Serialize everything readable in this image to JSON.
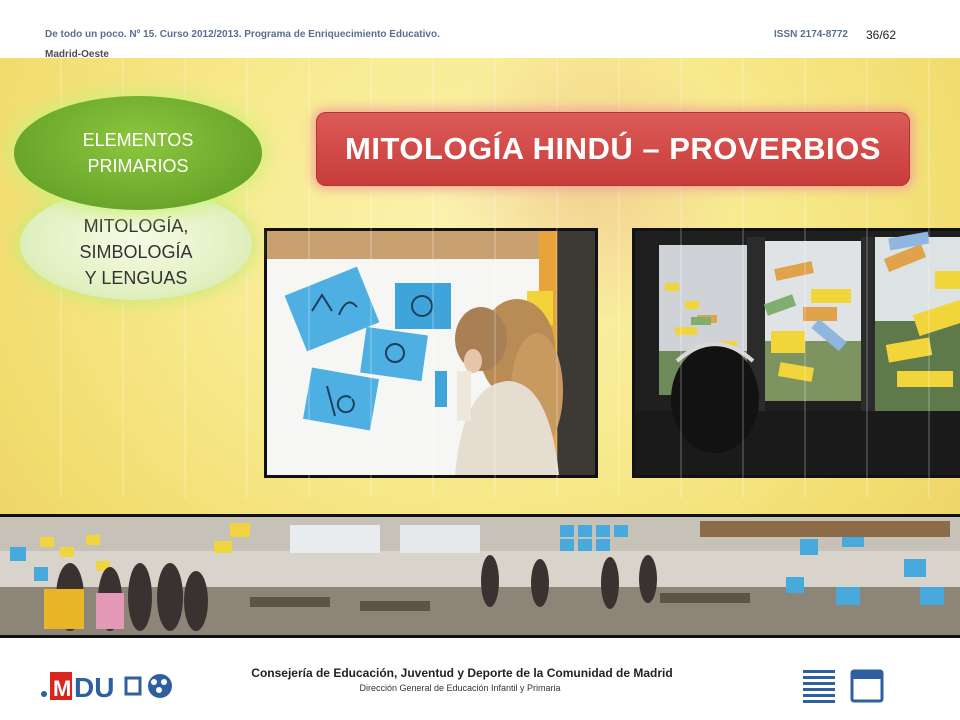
{
  "header": {
    "journal": "De todo un poco. Nº 15.  Curso 2012/2013. Programa de Enriquecimiento Educativo.",
    "region": "Madrid-Oeste",
    "issn": "ISSN 2174-8772",
    "page": "36/62"
  },
  "slide": {
    "title": "MITOLOGÍA HINDÚ – PROVERBIOS",
    "oval_top": [
      "ELEMENTOS",
      "PRIMARIOS"
    ],
    "oval_bottom": [
      "MITOLOGÍA,",
      "SIMBOLOGÍA",
      "Y LENGUAS"
    ]
  },
  "footer": {
    "logo": "MDU",
    "line1": "Consejería de Educación, Juventud y Deporte de la Comunidad de Madrid",
    "line2": "Dirección General de Educación Infantil y Primaria"
  },
  "icons": [
    "index-icon",
    "window-icon"
  ],
  "colors": {
    "green": "#6aa62a",
    "red": "#c83c3a",
    "blue": "#2f5f9e",
    "yellow": "#f3df75"
  }
}
